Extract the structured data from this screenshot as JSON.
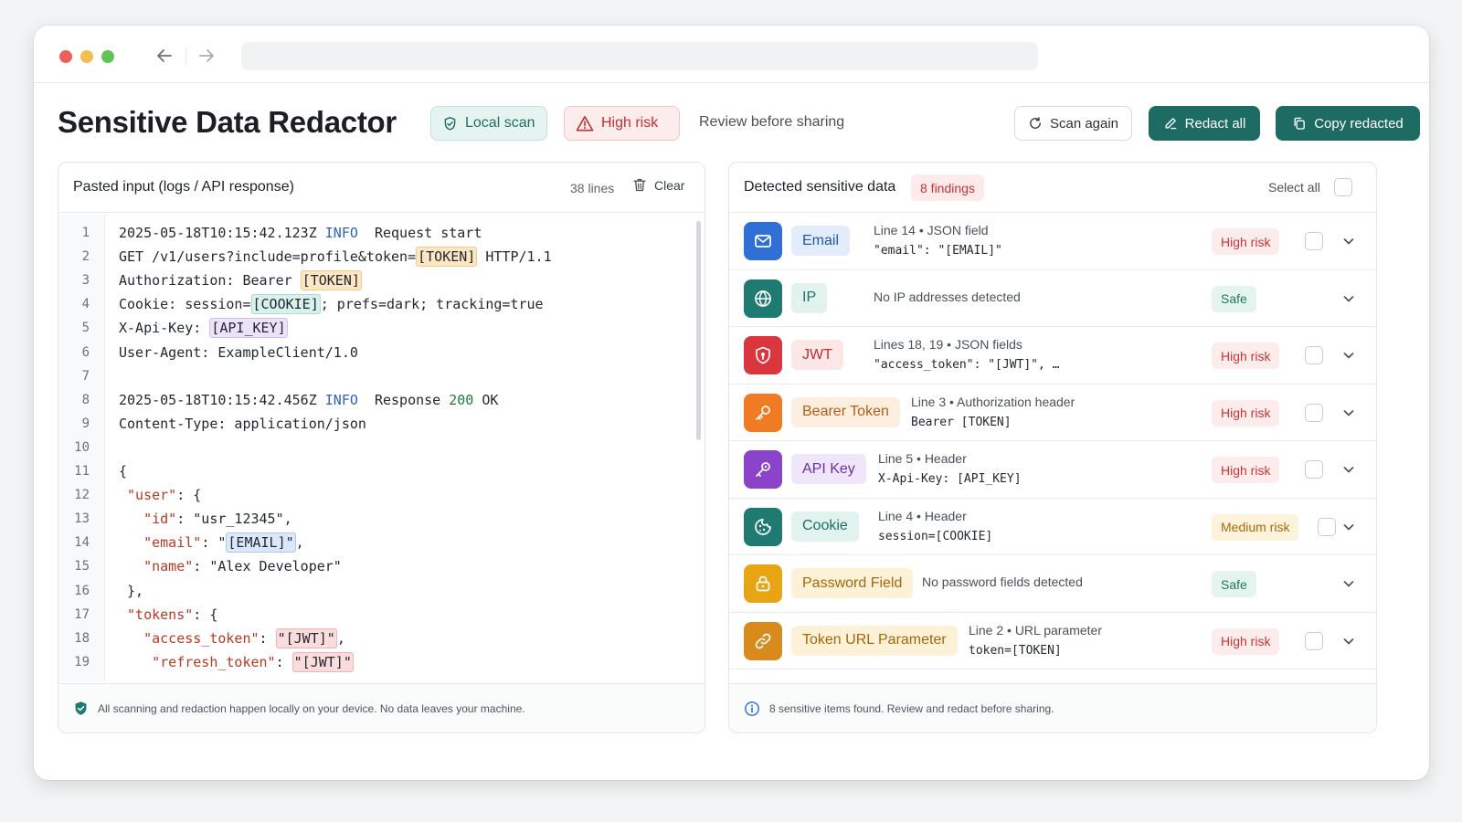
{
  "header": {
    "title": "Sensitive Data Redactor",
    "local_scan_label": "Local scan",
    "risk_label": "High risk",
    "review_text": "Review before sharing",
    "scan_again_label": "Scan again",
    "redact_all_label": "Redact all",
    "copy_redacted_label": "Copy redacted"
  },
  "input_panel": {
    "title": "Pasted input (logs / API response)",
    "lines_count": "38 lines",
    "clear_label": "Clear",
    "footer_text": "All scanning and redaction happen locally on your device. No data leaves your machine.",
    "lines": [
      {
        "n": "1",
        "parts": [
          {
            "t": "2025-05-18T10:15:42.123Z "
          },
          {
            "t": "INFO",
            "c": "kw-info"
          },
          {
            "t": "  Request start"
          }
        ]
      },
      {
        "n": "2",
        "parts": [
          {
            "t": "GET /v1/users?include=profile&token="
          },
          {
            "t": "[TOKEN]",
            "c": "tag token"
          },
          {
            "t": " HTTP/1.1"
          }
        ]
      },
      {
        "n": "3",
        "parts": [
          {
            "t": "Authorization: Bearer "
          },
          {
            "t": "[TOKEN]",
            "c": "tag token"
          }
        ]
      },
      {
        "n": "4",
        "parts": [
          {
            "t": "Cookie: session="
          },
          {
            "t": "[COOKIE]",
            "c": "tag cookie"
          },
          {
            "t": "; prefs=dark; tracking=true"
          }
        ]
      },
      {
        "n": "5",
        "parts": [
          {
            "t": "X-Api-Key: "
          },
          {
            "t": "[API_KEY]",
            "c": "tag api"
          }
        ]
      },
      {
        "n": "6",
        "parts": [
          {
            "t": "User-Agent: ExampleClient/1.0"
          }
        ]
      },
      {
        "n": "7",
        "parts": [
          {
            "t": ""
          }
        ]
      },
      {
        "n": "8",
        "parts": [
          {
            "t": "2025-05-18T10:15:42.456Z "
          },
          {
            "t": "INFO",
            "c": "kw-info"
          },
          {
            "t": "  Response "
          },
          {
            "t": "200",
            "c": "kw-200"
          },
          {
            "t": " OK"
          }
        ]
      },
      {
        "n": "9",
        "parts": [
          {
            "t": "Content-Type: application/json"
          }
        ]
      },
      {
        "n": "10",
        "parts": [
          {
            "t": ""
          }
        ]
      },
      {
        "n": "11",
        "parts": [
          {
            "t": "{"
          }
        ]
      },
      {
        "n": "12",
        "parts": [
          {
            "t": " "
          },
          {
            "t": "\"user\"",
            "c": "key"
          },
          {
            "t": ": {"
          }
        ]
      },
      {
        "n": "13",
        "parts": [
          {
            "t": "   "
          },
          {
            "t": "\"id\"",
            "c": "key"
          },
          {
            "t": ": \"usr_12345\","
          }
        ]
      },
      {
        "n": "14",
        "parts": [
          {
            "t": "   "
          },
          {
            "t": "\"email\"",
            "c": "key"
          },
          {
            "t": ": \""
          },
          {
            "t": "[EMAIL]\"",
            "c": "tag email"
          },
          {
            "t": ","
          }
        ]
      },
      {
        "n": "15",
        "parts": [
          {
            "t": "   "
          },
          {
            "t": "\"name\"",
            "c": "key"
          },
          {
            "t": ": \"Alex Developer\""
          }
        ]
      },
      {
        "n": "16",
        "parts": [
          {
            "t": " },"
          }
        ]
      },
      {
        "n": "17",
        "parts": [
          {
            "t": " "
          },
          {
            "t": "\"tokens\"",
            "c": "key"
          },
          {
            "t": ": {"
          }
        ]
      },
      {
        "n": "18",
        "parts": [
          {
            "t": "   "
          },
          {
            "t": "\"access_token\"",
            "c": "key"
          },
          {
            "t": ": "
          },
          {
            "t": "\"[JWT]\"",
            "c": "tag jwt"
          },
          {
            "t": ","
          }
        ]
      },
      {
        "n": "19",
        "parts": [
          {
            "t": "    "
          },
          {
            "t": "\"refresh_token\"",
            "c": "key"
          },
          {
            "t": ": "
          },
          {
            "t": "\"[JWT]\"",
            "c": "tag jwt"
          }
        ]
      }
    ]
  },
  "findings_panel": {
    "title": "Detected sensitive data",
    "findings_badge": "8 findings",
    "select_all_label": "Select all",
    "footer_text": "8 sensitive items found. Review and redact before sharing.",
    "items": [
      {
        "type": "Email",
        "icon": "mail-icon",
        "icon_bg": "#2f6fd6",
        "chip_bg": "#e3ecfb",
        "chip_fg": "#2456a8",
        "meta": "Line 14 • JSON field",
        "snippet": "\"email\": \"[EMAIL]\"",
        "risk": "High risk",
        "risk_class": "risk-high",
        "checkbox": true
      },
      {
        "type": "IP",
        "icon": "globe-icon",
        "icon_bg": "#1f7a72",
        "chip_bg": "#e1f2ef",
        "chip_fg": "#1f6f62",
        "single": "No IP addresses detected",
        "risk": "Safe",
        "risk_class": "risk-safe",
        "checkbox": false
      },
      {
        "type": "JWT",
        "icon": "shield-icon",
        "icon_bg": "#d9363e",
        "chip_bg": "#fce6e6",
        "chip_fg": "#c12f2f",
        "meta": "Lines 18, 19 • JSON fields",
        "snippet": "\"access_token\": \"[JWT]\", …",
        "risk": "High risk",
        "risk_class": "risk-high",
        "checkbox": true
      },
      {
        "type": "Bearer Token",
        "icon": "key-icon",
        "icon_bg": "#f07b22",
        "chip_bg": "#fdefe0",
        "chip_fg": "#b85a10",
        "meta": "Line 3 • Authorization header",
        "snippet": "Bearer [TOKEN]",
        "risk": "High risk",
        "risk_class": "risk-high",
        "checkbox": true
      },
      {
        "type": "API Key",
        "icon": "api-key-icon",
        "icon_bg": "#8b44c9",
        "chip_bg": "#f0e6fb",
        "chip_fg": "#6b2fa6",
        "meta": "Line 5 • Header",
        "snippet": "X-Api-Key: [API_KEY]",
        "risk": "High risk",
        "risk_class": "risk-high",
        "checkbox": true
      },
      {
        "type": "Cookie",
        "icon": "cookie-icon",
        "icon_bg": "#1f7a72",
        "chip_bg": "#e1f2ef",
        "chip_fg": "#1f6f62",
        "meta": "Line 4 • Header",
        "snippet": "session=[COOKIE]",
        "risk": "Medium risk",
        "risk_class": "risk-med",
        "checkbox": true
      },
      {
        "type": "Password Field",
        "icon": "lock-icon",
        "icon_bg": "#e9a413",
        "chip_bg": "#fdf1d8",
        "chip_fg": "#a4690a",
        "single": "No password fields detected",
        "risk": "Safe",
        "risk_class": "risk-safe",
        "checkbox": false
      },
      {
        "type": "Token URL Parameter",
        "icon": "link-icon",
        "icon_bg": "#d98a1c",
        "chip_bg": "#fdf1d8",
        "chip_fg": "#a4690a",
        "meta": "Line 2 • URL parameter",
        "snippet": "token=[TOKEN]",
        "risk": "High risk",
        "risk_class": "risk-high",
        "checkbox": true
      }
    ]
  },
  "colors": {
    "accent": "#1e6b63",
    "high_risk": "#c93535",
    "safe": "#1f7a5f",
    "medium_risk": "#a86b0c"
  }
}
